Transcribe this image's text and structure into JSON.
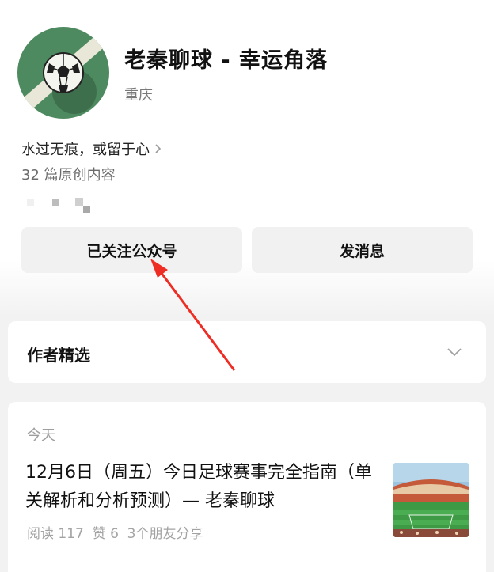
{
  "profile": {
    "name": "老秦聊球 - 幸运角落",
    "location": "重庆",
    "bio": "水过无痕，或留于心",
    "original_count": "32 篇原创内容"
  },
  "actions": {
    "follow_label": "已关注公众号",
    "message_label": "发消息"
  },
  "author_picks": {
    "title": "作者精选"
  },
  "article": {
    "date_label": "今天",
    "title": "12月6日（周五）今日足球赛事完全指南（单关解析和分析预测）— 老秦聊球",
    "meta": "阅读 117  赞 6  3个朋友分享"
  },
  "icons": {
    "avatar": "soccer-ball-avatar",
    "bio_chevron": "chevron-right-icon",
    "picks_chevron": "chevron-down-icon",
    "annotation": "red-arrow"
  },
  "colors": {
    "background": "#f2f2f2",
    "card": "#ffffff",
    "button_bg": "#f1f1f1",
    "annotation_red": "#ee2d24",
    "avatar_green": "#4e8a5f"
  }
}
